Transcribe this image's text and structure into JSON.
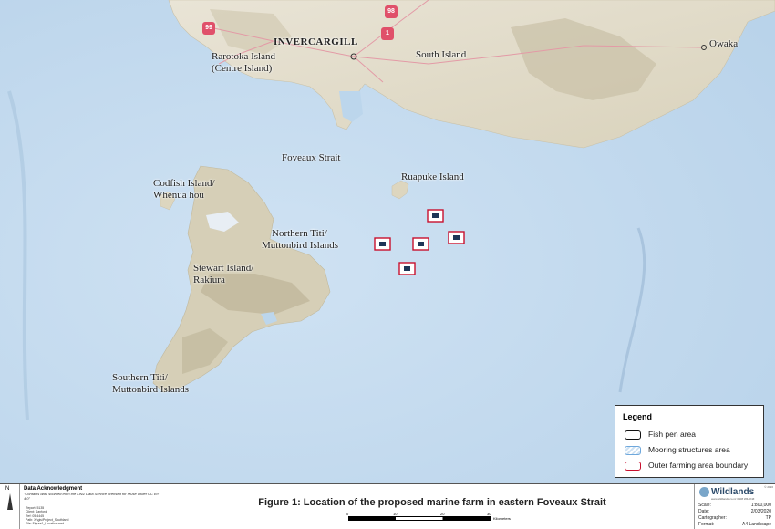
{
  "labels": {
    "invercargill": "INVERCARGILL",
    "owaka": "Owaka",
    "rarotoka_line1": "Rarotoka Island",
    "rarotoka_line2": "(Centre Island)",
    "south_island": "South Island",
    "foveaux_strait": "Foveaux Strait",
    "ruapuke": "Ruapuke Island",
    "codfish_line1": "Codfish Island/",
    "codfish_line2": "Whenua hou",
    "northern_titi_line1": "Northern Titi/",
    "northern_titi_line2": "Muttonbird Islands",
    "stewart_line1": "Stewart Island/",
    "stewart_line2": "Rakiura",
    "southern_titi_line1": "Southern Titi/",
    "southern_titi_line2": "Muttonbird Islands"
  },
  "roads": [
    "99",
    "98",
    "1"
  ],
  "legend": {
    "title": "Legend",
    "items": [
      {
        "label": "Fish pen area",
        "color": "#111111"
      },
      {
        "label": "Mooring structures area",
        "color": "#6fa8dc"
      },
      {
        "label": "Outer farming area boundary",
        "color": "#c8102e"
      }
    ]
  },
  "footer": {
    "north": "N",
    "ack_title": "Data Acknowledgment",
    "ack_text": "\"Contains data sourced from the LINZ Data Service licensed for reuse under CC BY 4.0\"",
    "meta": [
      {
        "k": "Report:",
        "v": "5135"
      },
      {
        "k": "Client:",
        "v": "Sanford"
      },
      {
        "k": "Ref:",
        "v": "05 4445"
      },
      {
        "k": "Path:",
        "v": "X:\\gis\\Project_Southland"
      },
      {
        "k": "File:",
        "v": "Figure1_Location.mxd"
      }
    ],
    "figure_title": "Figure 1: Location of the proposed marine farm in eastern Foveaux Strait",
    "scale_unit": "Kilometers",
    "scale_ticks": [
      "0",
      "10",
      "20",
      "30"
    ],
    "brand": "Wildlands",
    "brand_site": "www.wildlands.co.nz  0508 WILDNZ",
    "copyright": "© 2020",
    "info": [
      {
        "k": "Scale:",
        "v": "1:800,000"
      },
      {
        "k": "Date:",
        "v": "2/03/2020"
      },
      {
        "k": "Cartographer:",
        "v": "TP"
      },
      {
        "k": "Format:",
        "v": "A4 Landscape"
      }
    ]
  }
}
